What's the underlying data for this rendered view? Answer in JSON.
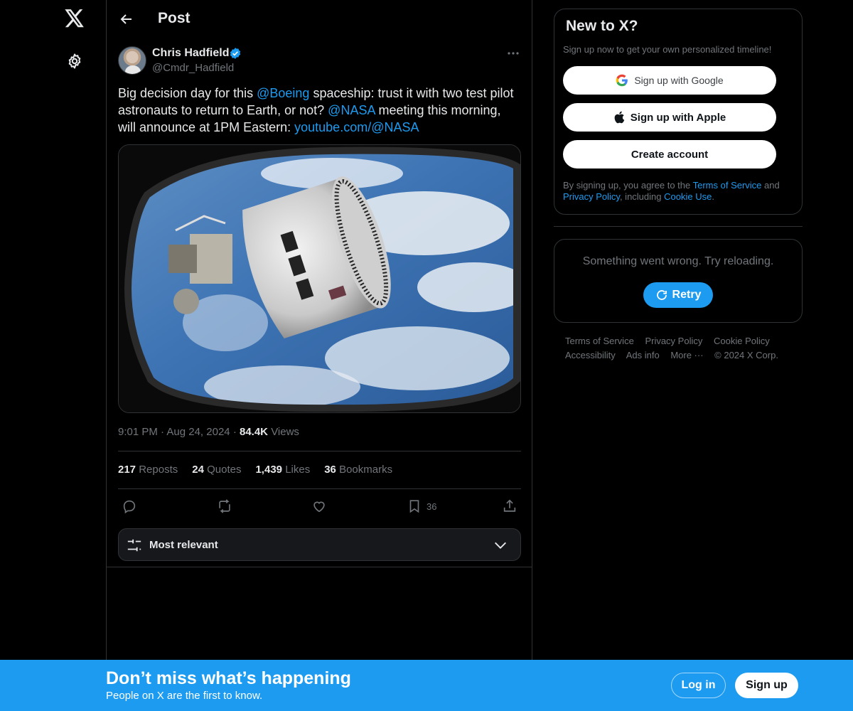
{
  "header": {
    "title": "Post"
  },
  "post": {
    "author_name": "Chris Hadfield",
    "author_handle": "@Cmdr_Hadfield",
    "text_part1": "Big decision day for this ",
    "mention_boeing": "@Boeing",
    "text_part2": " spaceship: trust it with two test pilot astronauts to return to Earth, or not? ",
    "mention_nasa": "@NASA",
    "text_part3": " meeting this morning, will announce at 1PM Eastern: ",
    "link": "youtube.com/@NASA",
    "time": "9:01 PM",
    "date": "Aug 24, 2024",
    "views_count": "84.4K",
    "views_label": "Views",
    "reposts_count": "217",
    "reposts_label": "Reposts",
    "quotes_count": "24",
    "quotes_label": "Quotes",
    "likes_count": "1,439",
    "likes_label": "Likes",
    "bookmarks_count": "36",
    "bookmarks_label": "Bookmarks",
    "bookmark_action_count": "36"
  },
  "sort": {
    "label": "Most relevant"
  },
  "signup_card": {
    "title": "New to X?",
    "subtitle": "Sign up now to get your own personalized timeline!",
    "google_label": "Sign up with Google",
    "apple_label": "Sign up with Apple",
    "create_label": "Create account",
    "terms_prefix": "By signing up, you agree to the ",
    "terms_link": "Terms of Service",
    "terms_and": " and ",
    "privacy_link": "Privacy Policy",
    "terms_including": ", including ",
    "cookie_link": "Cookie Use",
    "terms_end": "."
  },
  "error_card": {
    "message": "Something went wrong. Try reloading.",
    "retry_label": "Retry"
  },
  "footer": {
    "links": [
      "Terms of Service",
      "Privacy Policy",
      "Cookie Policy",
      "Accessibility",
      "Ads info",
      "More ···",
      "© 2024 X Corp."
    ]
  },
  "banner": {
    "headline": "Don’t miss what’s happening",
    "sub": "People on X are the first to know.",
    "login_label": "Log in",
    "signup_label": "Sign up"
  },
  "colors": {
    "accent": "#1d9bf0",
    "background": "#000000",
    "muted": "#71767b",
    "border": "#2f3336"
  }
}
